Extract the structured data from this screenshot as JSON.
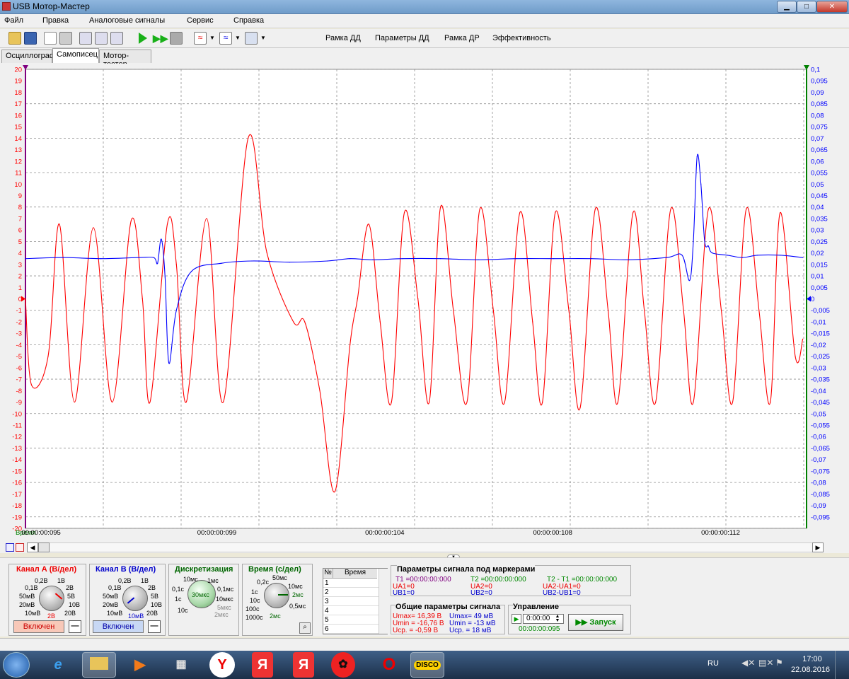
{
  "window": {
    "title": "USB Мотор-Мастер",
    "min": "▁",
    "max": "□",
    "close": "✕"
  },
  "menu": [
    "Файл",
    "Правка",
    "Аналоговые сигналы",
    "Сервис",
    "Справка"
  ],
  "toolbar": {
    "buttons": [
      "Рамка ДД",
      "Параметры ДД",
      "Рамка ДР",
      "Эффективность"
    ]
  },
  "tabs": [
    "Осциллограф",
    "Самописец",
    "Мотор-тестер"
  ],
  "active_tab": 1,
  "colors": {
    "channel_a": "#ff0000",
    "channel_b": "#0000ff",
    "marker_t1": "#800080",
    "marker_t2": "#008000",
    "grid": "#808080"
  },
  "plot": {
    "left_axis_ticks": [
      "20",
      "19",
      "18",
      "17",
      "16",
      "15",
      "14",
      "13",
      "12",
      "11",
      "10",
      "9",
      "8",
      "7",
      "6",
      "5",
      "4",
      "3",
      "2",
      "1",
      "0",
      "-1",
      "-2",
      "-3",
      "-4",
      "-5",
      "-6",
      "-7",
      "-8",
      "-9",
      "-10",
      "-11",
      "-12",
      "-13",
      "-14",
      "-15",
      "-16",
      "-17",
      "-18",
      "-19",
      "-20"
    ],
    "right_axis_ticks": [
      "0,1",
      "0,095",
      "0,09",
      "0,085",
      "0,08",
      "0,075",
      "0,07",
      "0,065",
      "0,06",
      "0,055",
      "0,05",
      "0,045",
      "0,04",
      "0,035",
      "0,03",
      "0,025",
      "0,02",
      "0,015",
      "0,01",
      "0,005",
      "0",
      "-0,005",
      "-0,01",
      "-0,015",
      "-0,02",
      "-0,025",
      "-0,03",
      "-0,035",
      "-0,04",
      "-0,045",
      "-0,05",
      "-0,055",
      "-0,06",
      "-0,065",
      "-0,07",
      "-0,075",
      "-0,08",
      "-0,085",
      "-0,09",
      "-0,095"
    ],
    "time_label": "Время",
    "time_ticks": [
      "00:00:00:095",
      "00:00:00:099",
      "00:00:00:104",
      "00:00:00:108",
      "00:00:00:112"
    ]
  },
  "chart_data": {
    "type": "line",
    "x_unit": "time",
    "x_tick_labels": [
      "00:00:00:095",
      "00:00:00:099",
      "00:00:00:104",
      "00:00:00:108",
      "00:00:00:112"
    ],
    "y_left_range": [
      -20,
      20
    ],
    "y_right_range": [
      -0.1,
      0.1
    ],
    "grid": true,
    "series": [
      {
        "axis": "left",
        "color": "#ff0000",
        "points": [
          [
            0,
            0
          ],
          [
            0.008,
            -7.5
          ],
          [
            0.03,
            -5
          ],
          [
            0.045,
            6.5
          ],
          [
            0.065,
            -9
          ],
          [
            0.09,
            6.2
          ],
          [
            0.115,
            -9
          ],
          [
            0.14,
            6.8
          ],
          [
            0.155,
            0
          ],
          [
            0.165,
            -9
          ],
          [
            0.188,
            6.5
          ],
          [
            0.2,
            3
          ],
          [
            0.213,
            -9
          ],
          [
            0.24,
            7
          ],
          [
            0.262,
            -9
          ],
          [
            0.295,
            14
          ],
          [
            0.32,
            4
          ],
          [
            0.355,
            -2
          ],
          [
            0.37,
            -2
          ],
          [
            0.39,
            -8
          ],
          [
            0.41,
            -16.8
          ],
          [
            0.43,
            -4
          ],
          [
            0.44,
            0
          ],
          [
            0.455,
            6.5
          ],
          [
            0.47,
            -2
          ],
          [
            0.485,
            -9
          ],
          [
            0.502,
            7.5
          ],
          [
            0.52,
            0
          ],
          [
            0.535,
            -9
          ],
          [
            0.55,
            8
          ],
          [
            0.567,
            -1
          ],
          [
            0.585,
            -9
          ],
          [
            0.602,
            7.8
          ],
          [
            0.62,
            -1
          ],
          [
            0.635,
            -9
          ],
          [
            0.655,
            7.5
          ],
          [
            0.672,
            -2
          ],
          [
            0.685,
            -9
          ],
          [
            0.702,
            7.5
          ],
          [
            0.72,
            -1
          ],
          [
            0.735,
            -9.5
          ],
          [
            0.755,
            7.8
          ],
          [
            0.772,
            -1
          ],
          [
            0.785,
            -9
          ],
          [
            0.805,
            7.5
          ],
          [
            0.82,
            -1
          ],
          [
            0.835,
            -9
          ],
          [
            0.855,
            7.8
          ],
          [
            0.872,
            -1
          ],
          [
            0.885,
            -9
          ],
          [
            0.905,
            7.8
          ],
          [
            0.922,
            -1
          ],
          [
            0.937,
            -9
          ],
          [
            0.955,
            7.8
          ],
          [
            0.972,
            -1
          ],
          [
            0.987,
            -9
          ],
          [
            1.0,
            7.5
          ],
          [
            1.02,
            -5
          ],
          [
            1.03,
            -3.5
          ]
        ]
      },
      {
        "axis": "right",
        "color": "#0000ff",
        "points": [
          [
            0,
            0.0175
          ],
          [
            0.05,
            0.018
          ],
          [
            0.1,
            0.0175
          ],
          [
            0.15,
            0.018
          ],
          [
            0.17,
            0.018
          ],
          [
            0.175,
            0.0155
          ],
          [
            0.18,
            0.026
          ],
          [
            0.185,
            0.0095
          ],
          [
            0.19,
            -0.028
          ],
          [
            0.2,
            -0.005
          ],
          [
            0.22,
            0.012
          ],
          [
            0.26,
            0.0155
          ],
          [
            0.3,
            0.0165
          ],
          [
            0.35,
            0.016
          ],
          [
            0.4,
            0.0165
          ],
          [
            0.43,
            0.0175
          ],
          [
            0.46,
            0.017
          ],
          [
            0.5,
            0.0175
          ],
          [
            0.55,
            0.0175
          ],
          [
            0.6,
            0.017
          ],
          [
            0.65,
            0.0175
          ],
          [
            0.7,
            0.0175
          ],
          [
            0.75,
            0.0175
          ],
          [
            0.8,
            0.017
          ],
          [
            0.85,
            0.018
          ],
          [
            0.87,
            0.019
          ],
          [
            0.88,
            0.008
          ],
          [
            0.885,
            0.025
          ],
          [
            0.89,
            0.062
          ],
          [
            0.895,
            0.05
          ],
          [
            0.9,
            0.025
          ],
          [
            0.905,
            0.023
          ],
          [
            0.91,
            0.02
          ],
          [
            0.93,
            0.019
          ],
          [
            0.95,
            0.018
          ],
          [
            0.97,
            0.019
          ],
          [
            1.0,
            0.019
          ],
          [
            1.03,
            0.018
          ]
        ]
      }
    ]
  },
  "chan_a": {
    "title": "Канал А (В/дел)",
    "labels": [
      "0,2В",
      "1В",
      "0,1В",
      "2В",
      "50мВ",
      "5В",
      "20мВ",
      "10В",
      "10мВ",
      "20В"
    ],
    "value": "2В",
    "button": "Включен",
    "minus": "—"
  },
  "chan_b": {
    "title": "Канал В (В/дел)",
    "labels": [
      "0,2В",
      "1В",
      "0,1В",
      "2В",
      "50мВ",
      "5В",
      "20мВ",
      "10В",
      "10мВ",
      "20В"
    ],
    "value": "10мВ",
    "button": "Включен",
    "minus": "—"
  },
  "disc": {
    "title": "Дискретизация",
    "labels": [
      "10мс",
      "1мс",
      "0,1с",
      "0,1мс",
      "1с",
      "10мкс",
      "10с",
      "5мкс",
      "2мкс"
    ],
    "value": "30мкс"
  },
  "time": {
    "title": "Время (с/дел)",
    "labels": [
      "50мс",
      "0,2с",
      "10мс",
      "1с",
      "2мс",
      "10с",
      "100с",
      "0,5мс",
      "1000с"
    ],
    "value": "2мс"
  },
  "table": {
    "col_no": "№",
    "col_time": "Время",
    "rows": [
      "1",
      "2",
      "3",
      "4",
      "5",
      "6"
    ]
  },
  "markers": {
    "title": "Параметры сигнала под маркерами",
    "t1": "T1 =00:00:00:000",
    "ua1": "UA1=0",
    "ub1": "UB1=0",
    "t2": "T2 =00:00:00:000",
    "ua2": "UA2=0",
    "ub2": "UB2=0",
    "dt": "T2 - T1 =00:00:00:000",
    "dua": "UA2-UA1=0",
    "dub": "UB2-UB1=0"
  },
  "general": {
    "title": "Общие параметры сигнала",
    "a_max": "Umax= 16,39 В",
    "a_min": "Umin = -16,76 В",
    "a_avg": "Uср. = -0,59 В",
    "b_max": "Umax= 49 мВ",
    "b_min": "Umin = -13 мВ",
    "b_avg": "Uср. = 18 мВ"
  },
  "control": {
    "title": "Управление",
    "time_value": "0:00:00",
    "current": "00:00:00:095",
    "start": "Запуск"
  },
  "taskbar": {
    "lang": "RU",
    "time": "17:00",
    "date": "22.08.2016",
    "disco": "DISCO"
  }
}
